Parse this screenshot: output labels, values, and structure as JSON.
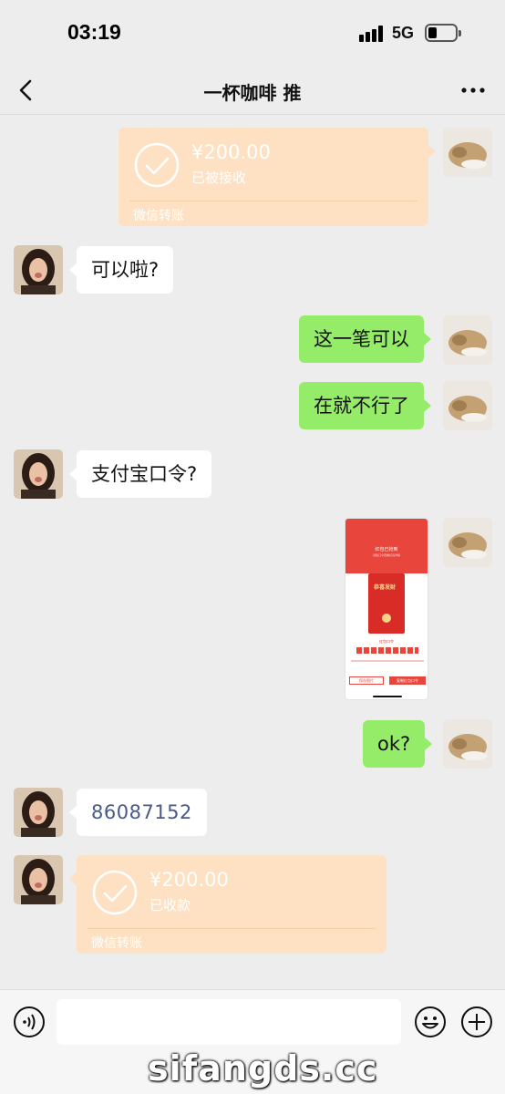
{
  "status_bar": {
    "time": "03:19",
    "network": "5G"
  },
  "nav": {
    "title": "一杯咖啡 推"
  },
  "messages": {
    "transfer_sent": {
      "amount": "¥200.00",
      "status": "已被接收",
      "footer": "微信转账"
    },
    "m1": "可以啦?",
    "m2": "这一笔可以",
    "m3": "在就不行了",
    "m4": "支付宝口令?",
    "m5": "ok?",
    "m6": "86087152",
    "transfer_received": {
      "amount": "¥200.00",
      "status": "已收款",
      "footer": "微信转账"
    }
  },
  "screenshot_thumb": {
    "header": "红包已抢到",
    "subheader": "领取口令查看红包详情",
    "card_text": "恭喜发财",
    "code_label": "红包口令",
    "btn_save": "保存图片",
    "btn_copy": "复制红包口令"
  },
  "watermark": "sifangds.cc",
  "colors": {
    "bg": "#ededed",
    "green_bubble": "#95ec69",
    "transfer": "#fde1c2",
    "number_text": "#4a5a86"
  }
}
